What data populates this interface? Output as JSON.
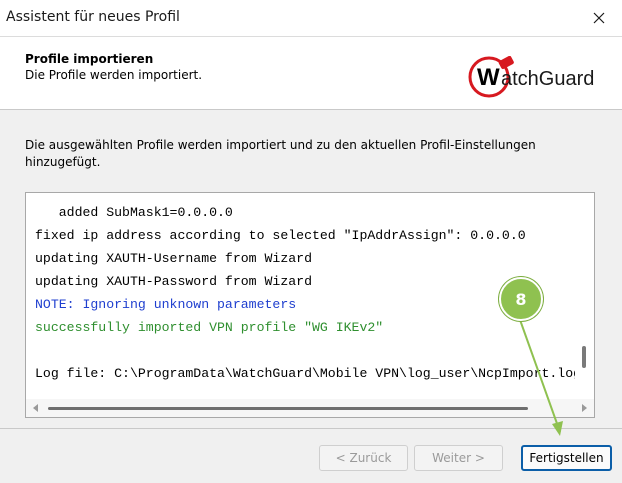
{
  "window": {
    "title": "Assistent für neues Profil",
    "close_icon": "close-icon"
  },
  "header": {
    "title": "Profile importieren",
    "subtitle": "Die Profile werden importiert.",
    "logo_text": "WatchGuard",
    "logo_color": "#d71920"
  },
  "description": "Die ausgewählten Profile werden importiert und zu den aktuellen Profil-Einstellungen hinzugefügt.",
  "log": {
    "lines": [
      {
        "text": "   added SubMask1=0.0.0.0",
        "color": "#000000"
      },
      {
        "text": "fixed ip address according to selected \"IpAddrAssign\": 0.0.0.0",
        "color": "#000000"
      },
      {
        "text": "updating XAUTH-Username from Wizard",
        "color": "#000000"
      },
      {
        "text": "updating XAUTH-Password from Wizard",
        "color": "#000000"
      },
      {
        "text": "NOTE: Ignoring unknown parameters",
        "color": "#1f3fcf"
      },
      {
        "text": "successfully imported VPN profile \"WG IKEv2\"",
        "color": "#2f8f2f"
      },
      {
        "text": "",
        "color": "#000000"
      },
      {
        "text": "Log file: C:\\ProgramData\\WatchGuard\\Mobile VPN\\log_user\\NcpImport.log",
        "color": "#000000"
      }
    ]
  },
  "buttons": {
    "back": "< Zurück",
    "next": "Weiter >",
    "finish": "Fertigstellen"
  },
  "annotation": {
    "step": "8",
    "color": "#8fc150"
  }
}
